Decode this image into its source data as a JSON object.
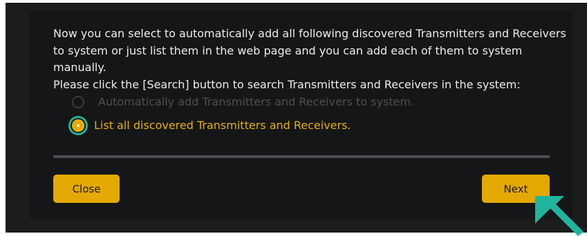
{
  "dialog": {
    "instructions": [
      "Now you can select to automatically add all following discovered Transmitters and Receivers",
      "to system or just list them in the web page and you can add each of them to system",
      "manually.",
      "Please click the [Search] button to search Transmitters and Receivers in the system:"
    ],
    "options": [
      {
        "label": "Automatically add Transmitters and Receivers to system.",
        "selected": false
      },
      {
        "label": "List all discovered Transmitters and Receivers.",
        "selected": true
      }
    ],
    "buttons": {
      "close_label": "Close",
      "next_label": "Next"
    }
  },
  "colors": {
    "accent": "#e3a900",
    "highlight_ring": "#1fb59d",
    "pointer": "#1fb59d",
    "panel_background": "#151617"
  },
  "icons": {
    "pointer": "arrow-pointer-icon"
  }
}
